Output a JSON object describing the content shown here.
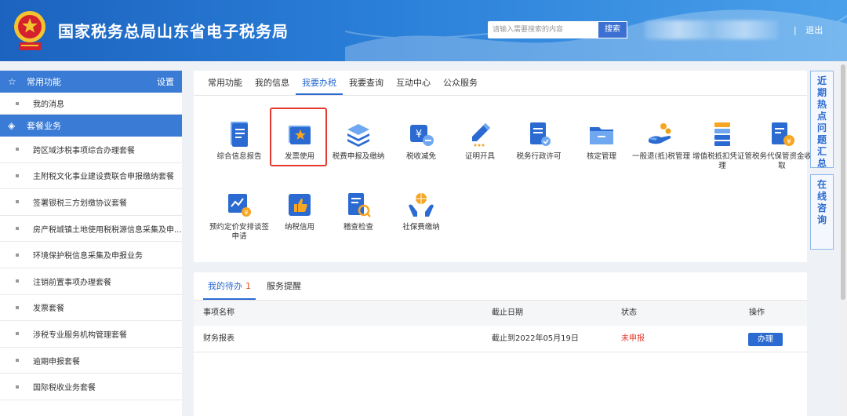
{
  "header": {
    "site_title": "国家税务总局山东省电子税务局",
    "search_placeholder": "请输入需要搜索的内容",
    "search_button": "搜索",
    "logout_sep": "|",
    "logout": "退出"
  },
  "sidebar": {
    "common_section": {
      "label": "常用功能",
      "settings": "设置",
      "icon": "star-icon"
    },
    "common_items": [
      "我的消息"
    ],
    "package_section": {
      "label": "套餐业务",
      "icon": "layers-icon"
    },
    "package_items": [
      "跨区域涉税事项综合办理套餐",
      "主附税文化事业建设费联合申报缴纳套餐",
      "签署银税三方划缴协议套餐",
      "房产税城镇土地使用税税源信息采集及申...",
      "环境保护税信息采集及申报业务",
      "注销前置事项办理套餐",
      "发票套餐",
      "涉税专业服务机构管理套餐",
      "逾期申报套餐",
      "国际税收业务套餐"
    ]
  },
  "tabs": [
    "常用功能",
    "我的信息",
    "我要办税",
    "我要查询",
    "互动中心",
    "公众服务"
  ],
  "active_tab": "我要办税",
  "tiles": [
    {
      "label": "综合信息报告",
      "icon": "document-report-icon"
    },
    {
      "label": "发票使用",
      "icon": "invoice-star-icon"
    },
    {
      "label": "税费申报及缴纳",
      "icon": "stacked-layers-icon"
    },
    {
      "label": "税收减免",
      "icon": "tax-relief-icon"
    },
    {
      "label": "证明开具",
      "icon": "pen-certificate-icon"
    },
    {
      "label": "税务行政许可",
      "icon": "license-document-icon"
    },
    {
      "label": "核定管理",
      "icon": "folder-icon"
    },
    {
      "label": "一般退(抵)税管理",
      "icon": "refund-hand-icon"
    },
    {
      "label": "增值税抵扣凭证管理",
      "icon": "voucher-stack-icon"
    },
    {
      "label": "税务代保管资金收取",
      "icon": "custody-fund-icon"
    },
    {
      "label": "预约定价安排谈签申请",
      "icon": "pricing-chart-icon"
    },
    {
      "label": "纳税信用",
      "icon": "thumbs-up-icon"
    },
    {
      "label": "稽查检查",
      "icon": "inspection-icon"
    },
    {
      "label": "社保费缴纳",
      "icon": "social-security-icon"
    }
  ],
  "float_links": [
    "近期热点问题汇总",
    "在线咨询"
  ],
  "todo": {
    "tabs": {
      "pending": "我的待办",
      "pending_count": "1",
      "reminder": "服务提醒"
    },
    "columns": [
      "事项名称",
      "截止日期",
      "状态",
      "操作"
    ],
    "rows": [
      {
        "name": "财务报表",
        "deadline": "截止到2022年05月19日",
        "status": "未申报",
        "action": "办理"
      }
    ]
  },
  "colors": {
    "brand_blue": "#2b6bd1",
    "header_gradient": [
      "#1c63bf",
      "#4aa0ea"
    ],
    "highlight_red": "#e23a2e"
  }
}
